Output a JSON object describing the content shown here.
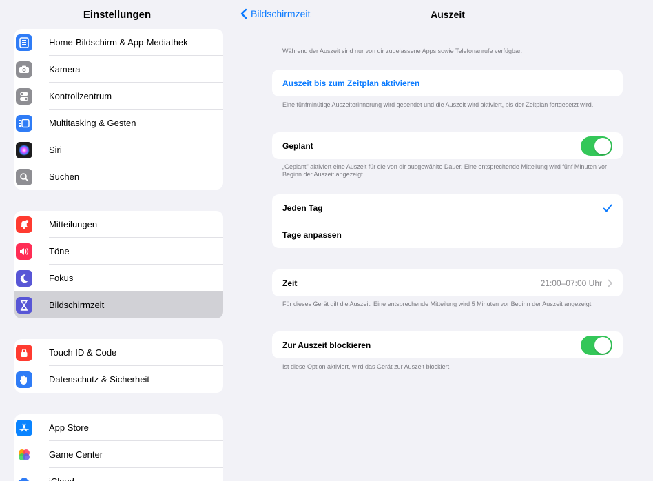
{
  "sidebar": {
    "title": "Einstellungen",
    "groups": [
      {
        "items": [
          {
            "label": "Home-Bildschirm & App-Mediathek",
            "icon": "home-screen-icon",
            "color": "#2f7cf6"
          },
          {
            "label": "Kamera",
            "icon": "camera-icon",
            "color": "#8e8e93"
          },
          {
            "label": "Kontrollzentrum",
            "icon": "control-center-icon",
            "color": "#8e8e93"
          },
          {
            "label": "Multitasking & Gesten",
            "icon": "multitasking-icon",
            "color": "#2f7cf6"
          },
          {
            "label": "Siri",
            "icon": "siri-icon",
            "color": "#222"
          },
          {
            "label": "Suchen",
            "icon": "search-icon",
            "color": "#8e8e93"
          }
        ]
      },
      {
        "items": [
          {
            "label": "Mitteilungen",
            "icon": "notifications-icon",
            "color": "#ff3b30"
          },
          {
            "label": "Töne",
            "icon": "sounds-icon",
            "color": "#ff2d55"
          },
          {
            "label": "Fokus",
            "icon": "focus-icon",
            "color": "#5856d6"
          },
          {
            "label": "Bildschirmzeit",
            "icon": "screen-time-icon",
            "color": "#5856d6",
            "selected": true
          }
        ]
      },
      {
        "items": [
          {
            "label": "Touch ID & Code",
            "icon": "touch-id-icon",
            "color": "#ff3b30"
          },
          {
            "label": "Datenschutz & Sicherheit",
            "icon": "privacy-hand-icon",
            "color": "#2f7cf6"
          }
        ]
      },
      {
        "items": [
          {
            "label": "App Store",
            "icon": "app-store-icon",
            "color": "#0a84ff"
          },
          {
            "label": "Game Center",
            "icon": "game-center-icon",
            "color": "#ff9f0a"
          },
          {
            "label": "iCloud",
            "icon": "icloud-icon",
            "color": "#2f7cf6"
          }
        ]
      }
    ]
  },
  "detail": {
    "back_label": "Bildschirmzeit",
    "title": "Auszeit",
    "intro_note": "Während der Auszeit sind nur von dir zugelassene Apps sowie Telefonanrufe verfügbar.",
    "activate_link": "Auszeit bis zum Zeitplan aktivieren",
    "activate_note": "Eine fünfminütige Auszeiterinnerung wird gesendet und die Auszeit wird aktiviert, bis der Zeitplan fortgesetzt wird.",
    "scheduled_label": "Geplant",
    "scheduled_on": true,
    "scheduled_note": "„Geplant\" aktiviert eine Auszeit für die von dir ausgewählte Dauer. Eine entsprechende Mitteilung wird fünf Minuten vor Beginn der Auszeit angezeigt.",
    "every_day_label": "Jeden Tag",
    "customize_days_label": "Tage anpassen",
    "time_label": "Zeit",
    "time_value": "21:00–07:00 Uhr",
    "time_note": "Für dieses Gerät gilt die Auszeit. Eine entsprechende Mitteilung wird 5 Minuten vor Beginn der Auszeit angezeigt.",
    "block_label": "Zur Auszeit blockieren",
    "block_on": true,
    "block_note": "Ist diese Option aktiviert, wird das Gerät zur Auszeit blockiert."
  },
  "colors": {
    "accent": "#0a7aff",
    "toggle_on": "#34c759",
    "background": "#f2f2f7"
  }
}
